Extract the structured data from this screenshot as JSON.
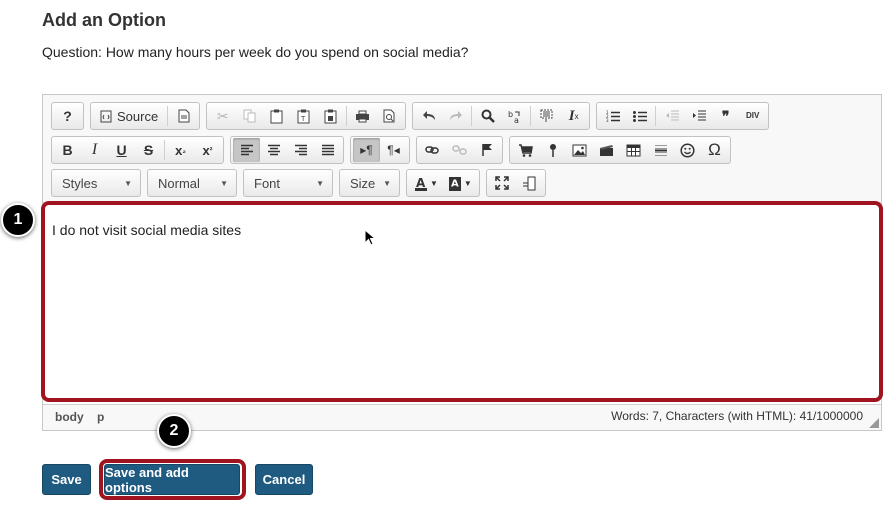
{
  "page": {
    "heading": "Add an Option",
    "question": "Question: How many hours per week do you spend on social media?"
  },
  "toolbar": {
    "source_label": "Source",
    "styles_label": "Styles",
    "format_label": "Normal",
    "font_label": "Font",
    "size_label": "Size",
    "bold_glyph": "B",
    "italic_glyph": "I",
    "underline_glyph": "U",
    "strike_glyph": "S",
    "help_glyph": "?",
    "omega_glyph": "Ω",
    "quote_glyph": "❞",
    "div_glyph": "DIV"
  },
  "editor": {
    "content": "I do not visit social media sites",
    "path": [
      "body",
      "p"
    ],
    "word_count": "Words: 7, Characters (with HTML): 41/1000000"
  },
  "callouts": {
    "one": "1",
    "two": "2"
  },
  "actions": {
    "save": "Save",
    "save_add": "Save and add options",
    "cancel": "Cancel"
  },
  "colors": {
    "accent": "#1f5a81",
    "highlight": "#a0141f"
  }
}
